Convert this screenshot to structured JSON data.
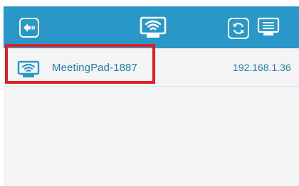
{
  "topbar": {
    "background_color": "#2a97c9",
    "icons": {
      "back": "back-arrow-icon",
      "title": "screen-mirror-wifi-icon",
      "refresh": "refresh-icon",
      "screen": "screen-mirror-icon"
    }
  },
  "device_list": [
    {
      "name": "MeetingPad-1887",
      "ip": "192.168.1.36",
      "icon": "screen-mirror-wifi-icon"
    }
  ],
  "highlight": {
    "color": "#e01e24",
    "target": "device-row-0"
  }
}
